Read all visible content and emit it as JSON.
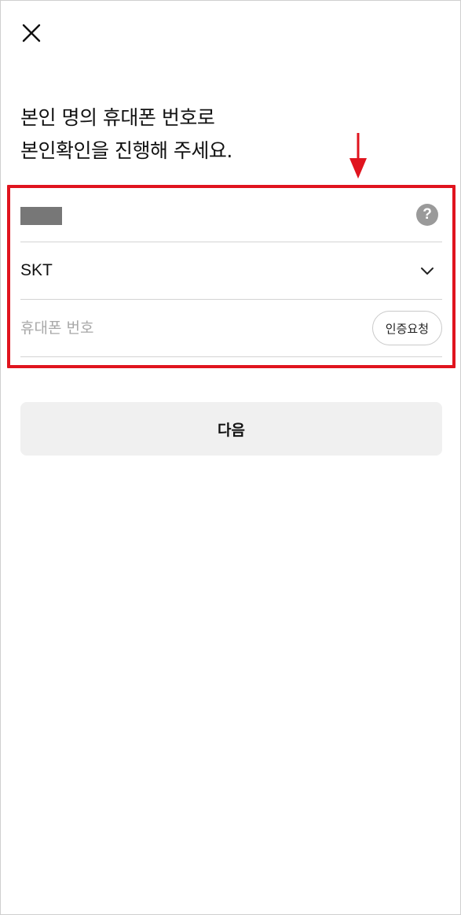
{
  "header": {
    "close_icon": "close-icon"
  },
  "headline": {
    "line1": "본인 명의 휴대폰 번호로",
    "line2": "본인확인을 진행해 주세요."
  },
  "form": {
    "name_field": {
      "value": "",
      "masked": true,
      "help_icon": "question-icon",
      "help_glyph": "?"
    },
    "carrier_field": {
      "value": "SKT",
      "dropdown_icon": "chevron-down-icon"
    },
    "phone_field": {
      "value": "",
      "placeholder": "휴대폰 번호"
    },
    "verify_button_label": "인증요청"
  },
  "next_button_label": "다음",
  "colors": {
    "highlight_border": "#e0141e",
    "arrow": "#e0141e",
    "next_button_bg": "#f0f0f0",
    "placeholder_text": "#a8a8a8",
    "divider": "#d4d4d4",
    "mask": "#777777"
  }
}
